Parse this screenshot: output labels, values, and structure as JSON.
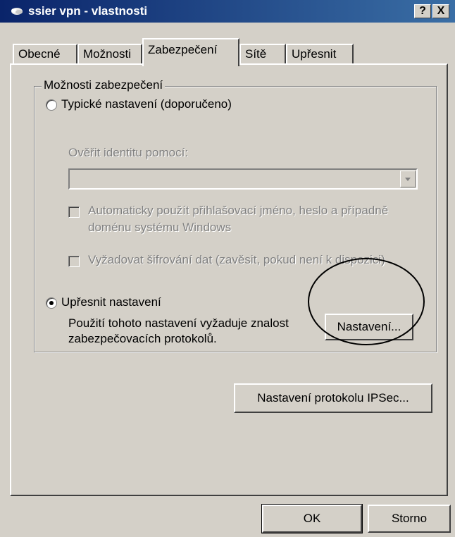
{
  "window": {
    "title": "ssier vpn - vlastnosti",
    "help_label": "?",
    "close_label": "X"
  },
  "tabs": [
    {
      "label": "Obecné",
      "active": false
    },
    {
      "label": "Možnosti",
      "active": false
    },
    {
      "label": "Zabezpečení",
      "active": true
    },
    {
      "label": "Sítě",
      "active": false
    },
    {
      "label": "Upřesnit",
      "active": false
    }
  ],
  "security": {
    "group_title": "Možnosti zabezpečení",
    "typical_label": "Typické nastavení (doporučeno)",
    "verify_label": "Ověřit identitu pomocí:",
    "verify_value": "",
    "auto_login_label_line1": "Automaticky použít přihlašovací jméno, heslo a případně",
    "auto_login_label_line2": "doménu systému Windows",
    "encryption_label": "Vyžadovat šifrování dat (zavěsit, pokud není k dispozici)",
    "advanced_label": "Upřesnit nastavení",
    "advanced_desc_line1": "Použití tohoto nastavení vyžaduje znalost",
    "advanced_desc_line2": "zabezpečovacích protokolů.",
    "settings_button": "Nastavení..."
  },
  "ipsec_button": "Nastavení protokolu IPSec...",
  "footer": {
    "ok_button": "OK",
    "cancel_button": "Storno"
  },
  "colors": {
    "titlebar_start": "#0a246a",
    "titlebar_end": "#3a6ea5",
    "face": "#d4d0c8",
    "disabled_text": "#808080"
  }
}
